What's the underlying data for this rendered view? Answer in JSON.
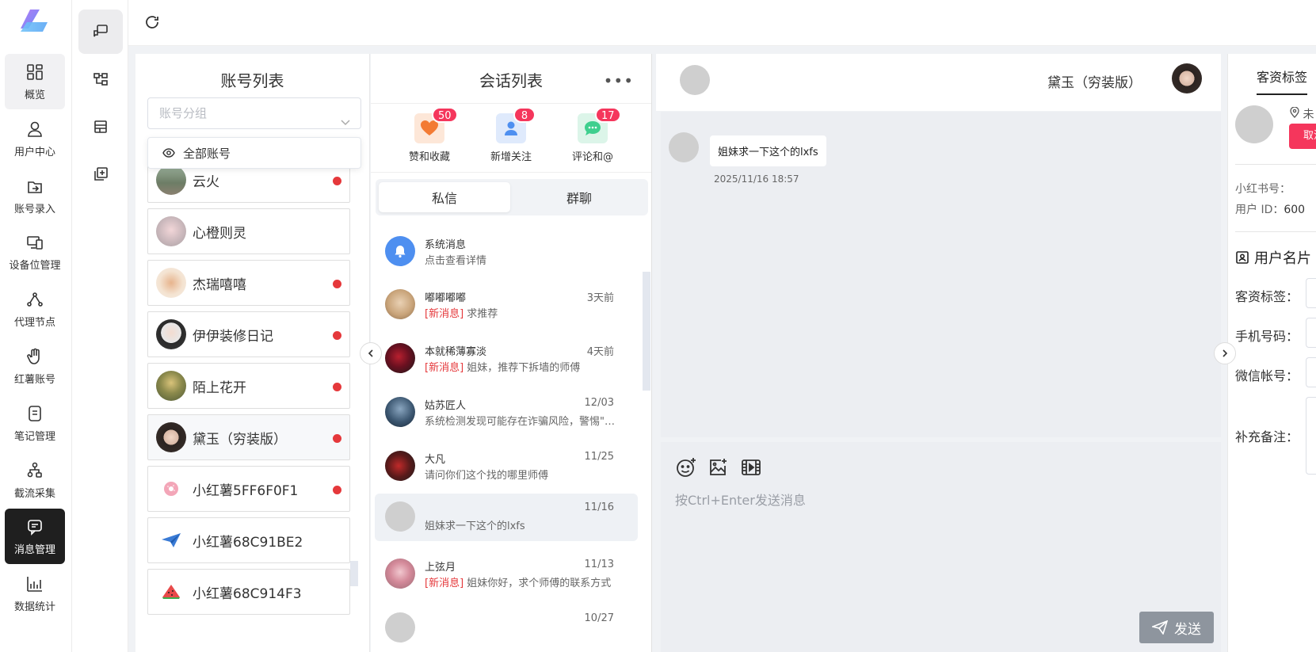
{
  "nav": [
    {
      "label": "概览",
      "icon": "dashboard-icon"
    },
    {
      "label": "用户中心",
      "icon": "user-icon"
    },
    {
      "label": "账号录入",
      "icon": "account-import-icon"
    },
    {
      "label": "设备位管理",
      "icon": "device-icon"
    },
    {
      "label": "代理节点",
      "icon": "proxy-node-icon"
    },
    {
      "label": "红薯账号",
      "icon": "hand-icon"
    },
    {
      "label": "笔记管理",
      "icon": "note-icon"
    },
    {
      "label": "截流采集",
      "icon": "collect-icon"
    },
    {
      "label": "消息管理",
      "icon": "message-icon"
    },
    {
      "label": "数据统计",
      "icon": "chart-icon"
    }
  ],
  "account_panel": {
    "title": "账号列表",
    "group_placeholder": "账号分组",
    "dropdown_option": "全部账号",
    "accounts": [
      {
        "name": "云火",
        "unread": true
      },
      {
        "name": "心橙则灵",
        "unread": false
      },
      {
        "name": "杰瑞嘻嘻",
        "unread": true
      },
      {
        "name": "伊伊装修日记",
        "unread": true
      },
      {
        "name": "陌上花开",
        "unread": true
      },
      {
        "name": "黛玉（穷装版）",
        "unread": true
      },
      {
        "name": "小红薯5FF6F0F1",
        "unread": true
      },
      {
        "name": "小红薯68C91BE2",
        "unread": false
      },
      {
        "name": "小红薯68C914F3",
        "unread": false
      }
    ]
  },
  "conversation_panel": {
    "title": "会话列表",
    "more": "•••",
    "notifications": [
      {
        "label": "赞和收藏",
        "count": "50",
        "color": "#f37b34"
      },
      {
        "label": "新增关注",
        "count": "8",
        "color": "#4e8ff0"
      },
      {
        "label": "评论和@",
        "count": "17",
        "color": "#3ecf8e"
      }
    ],
    "tabs": [
      "私信",
      "群聊"
    ],
    "conversations": [
      {
        "name": "系统消息",
        "time": "",
        "tag": "",
        "msg": "点击查看详情"
      },
      {
        "name": "嘟嘟嘟嘟",
        "time": "3天前",
        "tag": "[新消息]",
        "msg": " 求推荐"
      },
      {
        "name": "本就稀薄寡淡",
        "time": "4天前",
        "tag": "[新消息]",
        "msg": " 姐妹，推荐下拆墙的师傅"
      },
      {
        "name": "姑苏匠人",
        "time": "12/03",
        "tag": "",
        "msg": "系统检测发现可能存在诈骗风险，警惕\"兼..."
      },
      {
        "name": "大凡",
        "time": "11/25",
        "tag": "",
        "msg": "请问你们这个找的哪里师傅"
      },
      {
        "name": "",
        "time": "11/16",
        "tag": "",
        "msg": "姐妹求一下这个的lxfs"
      },
      {
        "name": "上弦月",
        "time": "11/13",
        "tag": "[新消息]",
        "msg": " 姐妹你好，求个师傅的联系方式"
      },
      {
        "name": "",
        "time": "10/27",
        "tag": "",
        "msg": ""
      }
    ]
  },
  "chat": {
    "contact_name": "黛玉（穷装版）",
    "message_text": "姐妹求一下这个的lxfs",
    "message_time": "2025/11/16 18:57",
    "input_placeholder": "按Ctrl+Enter发送消息",
    "send_label": "发送"
  },
  "profile": {
    "tab_label": "客资标签",
    "location": "未",
    "cancel_label": "取消",
    "xhs_label": "小红书号：",
    "uid_label": "用户 ID：",
    "uid_value": "600",
    "section_title": "用户名片",
    "fields": [
      "客资标签：",
      "手机号码：",
      "微信帐号：",
      "补充备注："
    ]
  }
}
